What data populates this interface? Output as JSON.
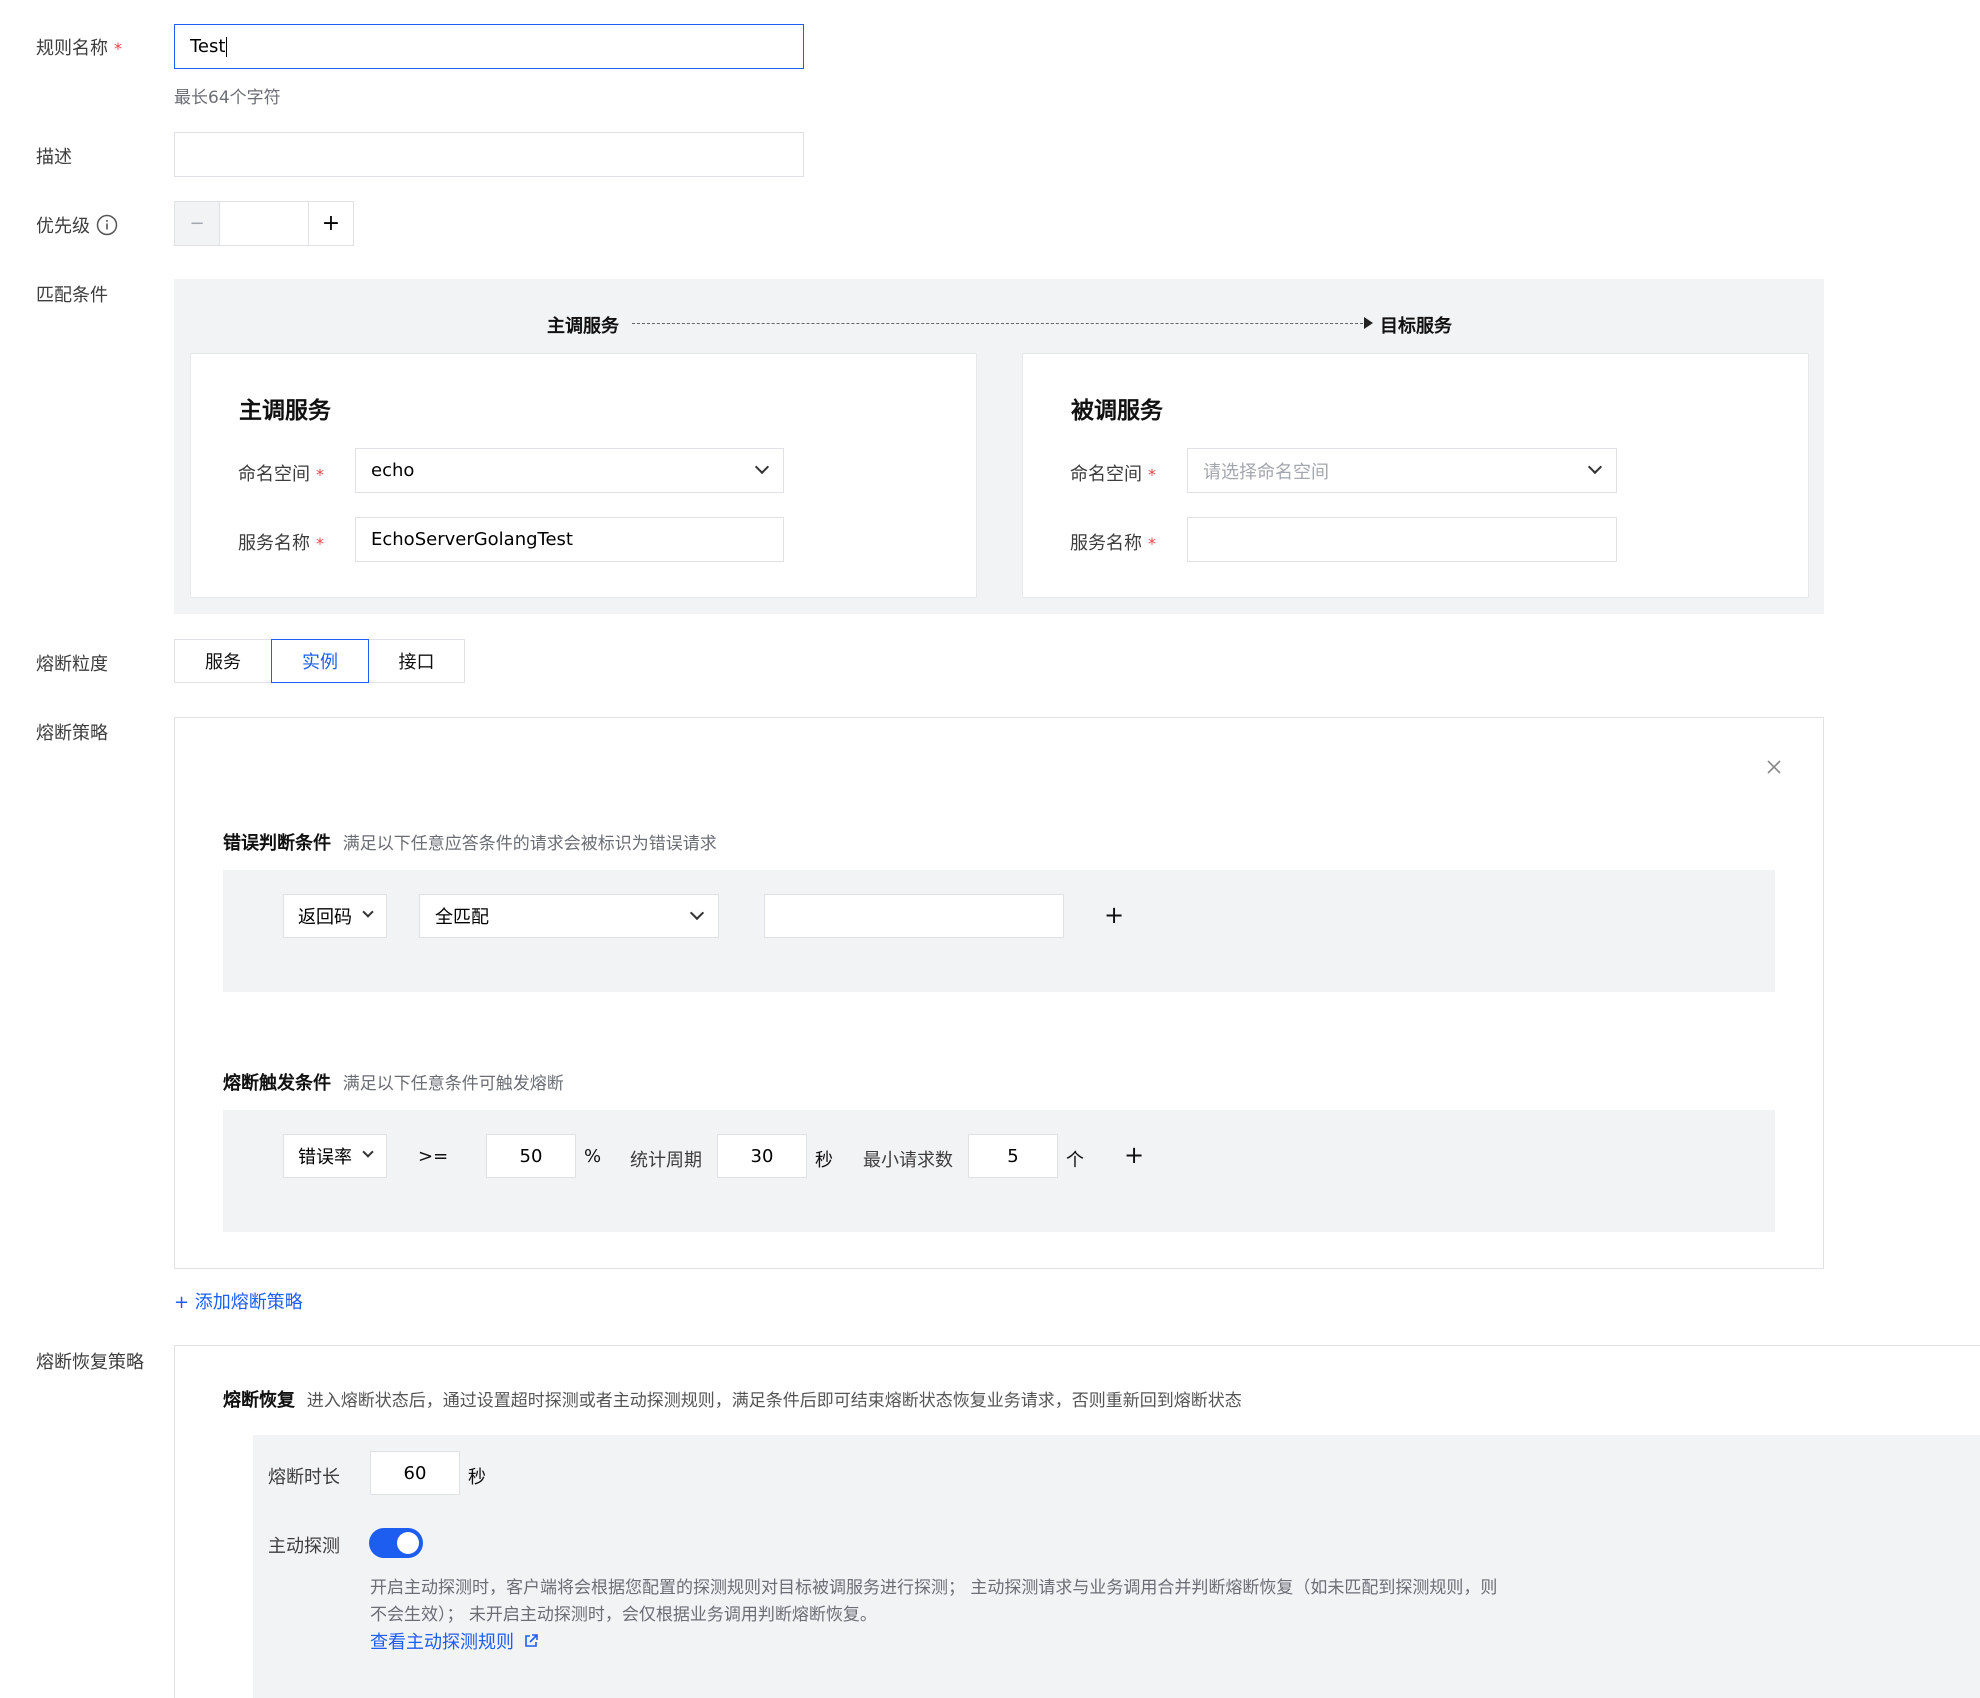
{
  "form": {
    "rule_name": {
      "label": "规则名称",
      "required_mark": "*",
      "value": "Test",
      "hint": "最长64个字符"
    },
    "description": {
      "label": "描述",
      "value": ""
    },
    "priority": {
      "label": "优先级",
      "info_icon": "info-icon",
      "minus": "−",
      "plus": "+",
      "value": ""
    },
    "match": {
      "label": "匹配条件",
      "flow_from": "主调服务",
      "flow_to": "目标服务",
      "caller": {
        "title": "主调服务",
        "namespace_label": "命名空间",
        "namespace_value": "echo",
        "service_label": "服务名称",
        "service_value": "EchoServerGolangTest"
      },
      "callee": {
        "title": "被调服务",
        "namespace_label": "命名空间",
        "namespace_placeholder": "请选择命名空间",
        "service_label": "服务名称",
        "service_value": ""
      }
    },
    "granularity": {
      "label": "熔断粒度",
      "options": [
        "服务",
        "实例",
        "接口"
      ],
      "selected": "实例"
    },
    "strategy": {
      "label": "熔断策略",
      "close_icon": "close-icon",
      "error_title": "错误判断条件",
      "error_desc": "满足以下任意应答条件的请求会被标识为错误请求",
      "error_type": "返回码",
      "match_mode": "全匹配",
      "error_value": "",
      "trigger_title": "熔断触发条件",
      "trigger_desc": "满足以下任意条件可触发熔断",
      "trigger_type": "错误率",
      "operator": ">=",
      "threshold": "50",
      "percent": "%",
      "period_label": "统计周期",
      "period_value": "30",
      "period_unit": "秒",
      "min_req_label": "最小请求数",
      "min_req_value": "5",
      "min_req_unit": "个",
      "add_label": "+ 添加熔断策略"
    },
    "recovery": {
      "label": "熔断恢复策略",
      "title": "熔断恢复",
      "desc": "进入熔断状态后，通过设置超时探测或者主动探测规则，满足条件后即可结束熔断状态恢复业务请求，否则重新回到熔断状态",
      "duration_label": "熔断时长",
      "duration_value": "60",
      "duration_unit": "秒",
      "probe_label": "主动探测",
      "probe_enabled": true,
      "probe_desc_line1": "开启主动探测时，客户端将会根据您配置的探测规则对目标被调服务进行探测； 主动探测请求与业务调用合并判断熔断恢复（如未匹配到探测规则，则",
      "probe_desc_line2": "不会生效）；  未开启主动探测时，会仅根据业务调用判断熔断恢复。",
      "probe_link": "查看主动探测规则"
    }
  },
  "colors": {
    "accent": "#1d5ef0",
    "required": "#e54545",
    "panel": "#f2f3f5"
  }
}
